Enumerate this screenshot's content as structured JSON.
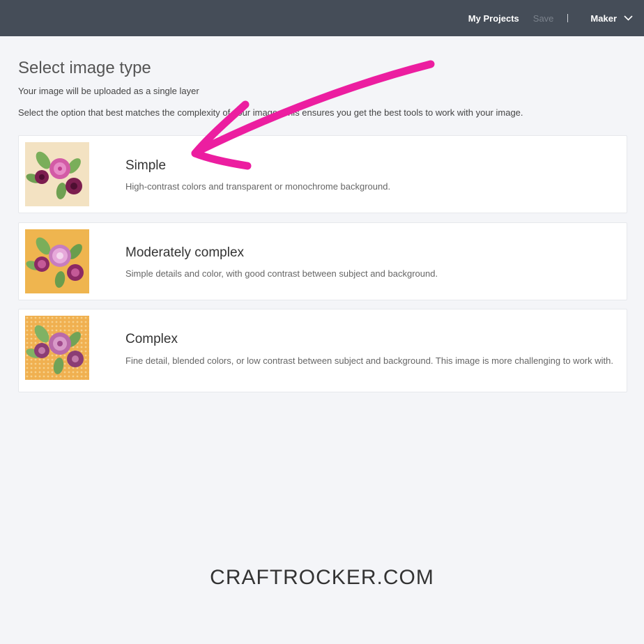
{
  "header": {
    "my_projects": "My Projects",
    "save": "Save",
    "separator": "|",
    "maker": "Maker"
  },
  "main": {
    "title": "Select image type",
    "subtitle": "Your image will be uploaded as a single layer",
    "instructions": "Select the option that best matches the complexity of your image. This ensures you get the best tools to work with your image."
  },
  "options": [
    {
      "title": "Simple",
      "description": "High-contrast colors and transparent or monochrome background.",
      "thumb_bg": "#f3e2c2"
    },
    {
      "title": "Moderately complex",
      "description": "Simple details and color, with good contrast between subject and background.",
      "thumb_bg": "#efb54f"
    },
    {
      "title": "Complex",
      "description": "Fine detail, blended colors, or low contrast between subject and background. This image is more challenging to work with.",
      "thumb_bg": "#f0b050"
    }
  ],
  "footer": {
    "watermark": "CRAFTROCKER.COM"
  },
  "colors": {
    "topbar": "#454d58",
    "arrow": "#ec1ea0",
    "background": "#f4f5f8"
  },
  "icons": {
    "maker_dropdown": "chevron-down-icon",
    "annotation": "arrow-annotation"
  }
}
